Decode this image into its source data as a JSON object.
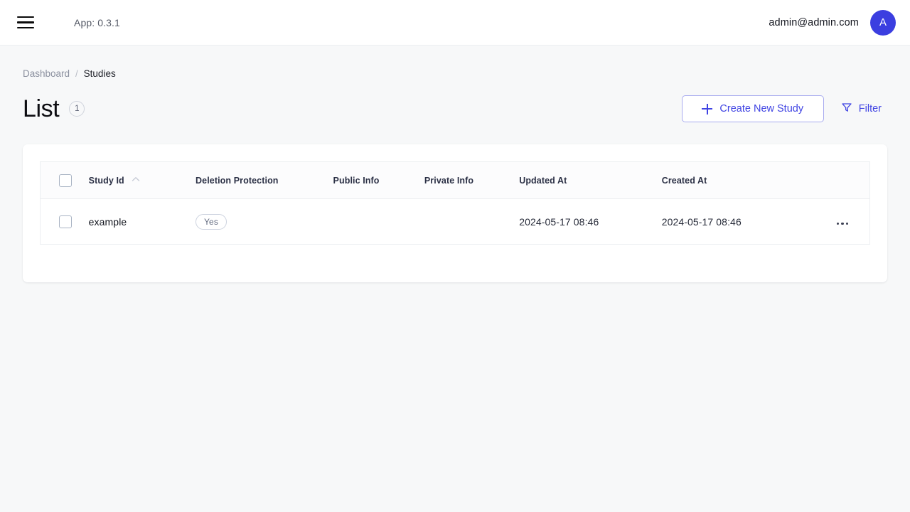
{
  "appbar": {
    "menu_icon": "hamburger-menu-icon",
    "app_version_label": "App: 0.3.1",
    "user_email": "admin@admin.com",
    "avatar_initial": "A",
    "avatar_color": "#3b3ee0"
  },
  "breadcrumb": {
    "parent": "Dashboard",
    "separator": "/",
    "current": "Studies"
  },
  "header": {
    "title": "List",
    "count_badge": "1",
    "create_button_label": "Create New Study",
    "create_button_icon": "plus-icon",
    "filter_button_label": "Filter",
    "filter_button_icon": "funnel-filter-icon",
    "accent_color": "#4044e3"
  },
  "table": {
    "select_all_checkbox": "select-all-checkbox",
    "sort_column": "Study Id",
    "sort_direction": "ascending",
    "columns": [
      {
        "key": "study_id",
        "label": "Study Id",
        "sortable": true
      },
      {
        "key": "deletion_protection",
        "label": "Deletion Protection",
        "sortable": false
      },
      {
        "key": "public_info",
        "label": "Public Info",
        "sortable": false
      },
      {
        "key": "private_info",
        "label": "Private Info",
        "sortable": false
      },
      {
        "key": "updated_at",
        "label": "Updated At",
        "sortable": false
      },
      {
        "key": "created_at",
        "label": "Created At",
        "sortable": false
      }
    ],
    "rows": [
      {
        "selected": false,
        "study_id": "example",
        "deletion_protection": "Yes",
        "public_info": "",
        "private_info": "",
        "updated_at": "2024-05-17 08:46",
        "created_at": "2024-05-17 08:46",
        "row_actions_icon": "ellipsis-horizontal-icon"
      }
    ]
  }
}
